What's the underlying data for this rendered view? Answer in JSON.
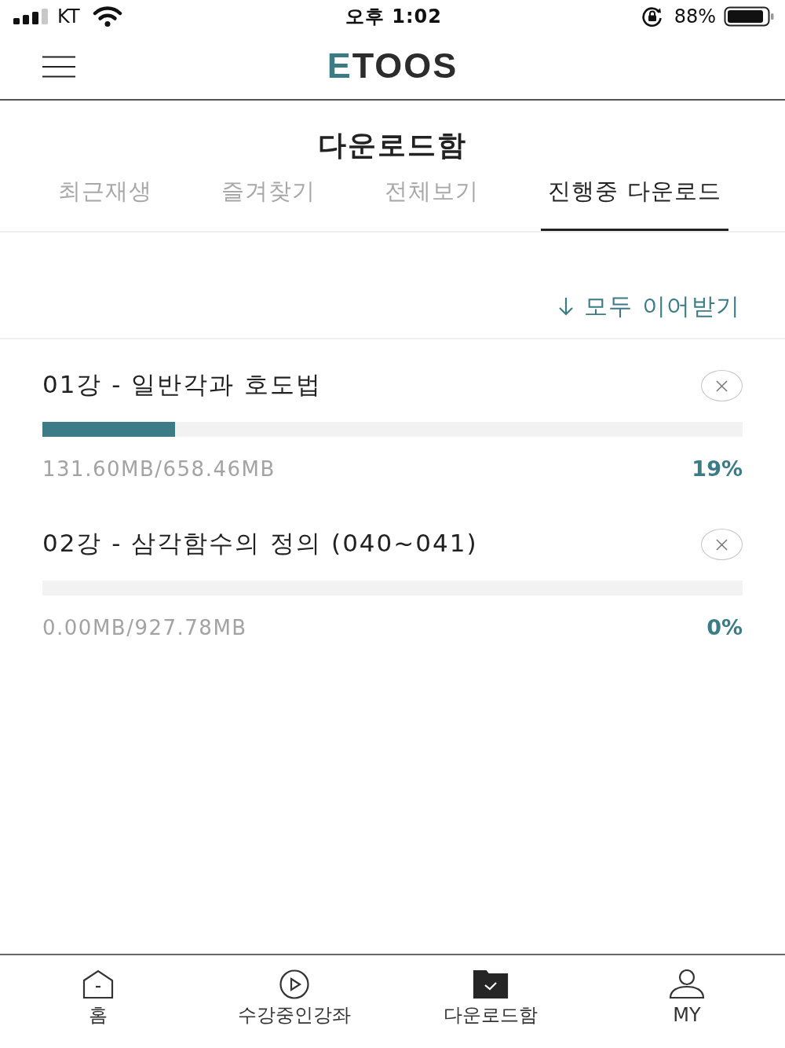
{
  "status_bar": {
    "carrier": "KT",
    "time": "오후 1:02",
    "battery": "88%"
  },
  "header": {
    "logo": "ETOOS"
  },
  "page_title": "다운로드함",
  "tabs": [
    {
      "label": "최근재생",
      "selected": false
    },
    {
      "label": "즐겨찾기",
      "selected": false
    },
    {
      "label": "전체보기",
      "selected": false
    },
    {
      "label": "진행중 다운로드",
      "selected": true
    }
  ],
  "resume_all": {
    "label": "모두 이어받기"
  },
  "downloads": [
    {
      "title": "01강 - 일반각과 호도법",
      "level": 0.19,
      "size": "131.60MB/658.46MB",
      "percent": "19%"
    },
    {
      "title": "02강 - 삼각함수의 정의 (040~041)",
      "level": 0,
      "size": "0.00MB/927.78MB",
      "percent": "0%"
    }
  ],
  "bottom_nav": [
    {
      "label": "홈",
      "selected": false
    },
    {
      "label": "수강중인강좌",
      "selected": false
    },
    {
      "label": "다운로드함",
      "selected": true
    },
    {
      "label": "MY",
      "selected": false
    }
  ]
}
